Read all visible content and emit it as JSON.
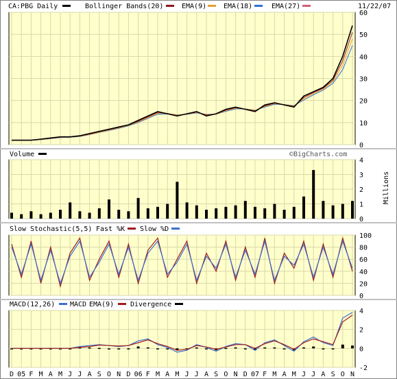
{
  "header": {
    "symbol_label": "CA:PBG Daily",
    "bollinger_label": "Bollinger Bands(20)",
    "ema1_label": "EMA(9)",
    "ema2_label": "EMA(18)",
    "ema3_label": "EMA(27)",
    "date": "11/22/07"
  },
  "colors": {
    "panel_bg": "#ffffcc",
    "grid": "#d8d8a8",
    "price": "#000000",
    "bollinger": "#8b1a1a",
    "ema9": "#9e1b1b",
    "ema18": "#e0a030",
    "ema27": "#2b6fd6",
    "fast_k": "#9e1b1b",
    "slow_d": "#3b6fd0",
    "macd": "#3b6fd0",
    "macd_ema": "#9e1b1b",
    "divergence": "#000000"
  },
  "panels": {
    "volume": {
      "label": "Volume",
      "watermark": "©BigCharts.com",
      "unit": "Millions"
    },
    "stochastic": {
      "label": "Slow Stochastic(5,5)",
      "fast_label": "Fast %K",
      "slow_label": "Slow %D"
    },
    "macd": {
      "label": "MACD(12,26)",
      "macd_label": "MACD",
      "ema_label": "EMA(9)",
      "divergence_label": "Divergence"
    }
  },
  "chart_data": [
    {
      "type": "line",
      "title": "CA:PBG Daily",
      "ylim": [
        0,
        60
      ],
      "yticks": [
        0,
        10,
        20,
        30,
        40,
        50,
        60
      ],
      "x": [
        "D",
        "05",
        "F",
        "M",
        "A",
        "M",
        "J",
        "J",
        "A",
        "S",
        "O",
        "N",
        "D",
        "06",
        "F",
        "M",
        "A",
        "M",
        "J",
        "J",
        "A",
        "S",
        "O",
        "N",
        "D",
        "07",
        "F",
        "M",
        "A",
        "M",
        "J",
        "J",
        "A",
        "S",
        "O",
        "N"
      ],
      "series": [
        {
          "name": "CA:PBG",
          "values": [
            2,
            2,
            2,
            2.5,
            3,
            3.5,
            3.5,
            4,
            5,
            6,
            7,
            8,
            9,
            11,
            13,
            15,
            14,
            13,
            14,
            15,
            13,
            14,
            16,
            17,
            16,
            15,
            18,
            19,
            18,
            17,
            22,
            24,
            26,
            30,
            40,
            54
          ]
        },
        {
          "name": "EMA(9)",
          "values": [
            2,
            2,
            2,
            2.4,
            2.9,
            3.4,
            3.5,
            3.9,
            4.8,
            5.8,
            6.8,
            7.8,
            8.9,
            10.6,
            12.6,
            14.6,
            14.1,
            13.2,
            13.9,
            14.8,
            13.4,
            13.9,
            15.7,
            16.8,
            16.1,
            15.3,
            17.6,
            18.8,
            18.1,
            17.3,
            21.4,
            23.6,
            25.6,
            29.2,
            38,
            51
          ]
        },
        {
          "name": "EMA(18)",
          "values": [
            2,
            2,
            2,
            2.3,
            2.8,
            3.3,
            3.4,
            3.8,
            4.6,
            5.6,
            6.6,
            7.6,
            8.7,
            10.3,
            12.2,
            14.2,
            14.1,
            13.4,
            13.8,
            14.6,
            13.6,
            13.8,
            15.4,
            16.5,
            16.2,
            15.5,
            17.3,
            18.6,
            18.2,
            17.5,
            20.8,
            23.1,
            25.2,
            28.5,
            36,
            48
          ]
        },
        {
          "name": "EMA(27)",
          "values": [
            2,
            2,
            2,
            2.2,
            2.7,
            3.2,
            3.3,
            3.7,
            4.5,
            5.5,
            6.4,
            7.4,
            8.5,
            10,
            11.9,
            13.8,
            13.9,
            13.5,
            13.7,
            14.4,
            13.7,
            13.8,
            15.1,
            16.2,
            16.2,
            15.6,
            17,
            18.3,
            18.2,
            17.7,
            20.2,
            22.6,
            24.7,
            27.8,
            34,
            45
          ]
        }
      ]
    },
    {
      "type": "bar",
      "title": "Volume",
      "ylabel": "Millions",
      "ylim": [
        0,
        4
      ],
      "yticks": [
        0,
        1,
        2,
        3,
        4
      ],
      "values": [
        0.4,
        0.3,
        0.5,
        0.3,
        0.4,
        0.6,
        1.1,
        0.5,
        0.4,
        0.7,
        1.3,
        0.6,
        0.5,
        1.4,
        0.7,
        0.8,
        1.0,
        2.5,
        1.1,
        0.9,
        0.6,
        0.7,
        0.8,
        0.9,
        1.2,
        0.8,
        0.7,
        1.0,
        0.6,
        0.8,
        1.5,
        3.3,
        1.2,
        0.9,
        1.0,
        1.2
      ]
    },
    {
      "type": "line",
      "title": "Slow Stochastic(5,5)",
      "ylim": [
        0,
        100
      ],
      "yticks": [
        0,
        20,
        40,
        60,
        80,
        100
      ],
      "series": [
        {
          "name": "Fast %K",
          "values": [
            85,
            30,
            90,
            20,
            80,
            15,
            70,
            95,
            25,
            60,
            90,
            30,
            85,
            20,
            75,
            95,
            30,
            60,
            90,
            20,
            70,
            40,
            90,
            25,
            80,
            30,
            95,
            20,
            70,
            45,
            90,
            25,
            85,
            30,
            95,
            40
          ]
        },
        {
          "name": "Slow %D",
          "values": [
            80,
            35,
            85,
            25,
            75,
            20,
            65,
            90,
            30,
            55,
            85,
            35,
            80,
            25,
            70,
            90,
            35,
            55,
            85,
            25,
            65,
            45,
            85,
            30,
            75,
            35,
            90,
            25,
            65,
            50,
            85,
            30,
            80,
            35,
            90,
            45
          ]
        }
      ]
    },
    {
      "type": "line",
      "title": "MACD(12,26)",
      "ylim": [
        -2,
        4
      ],
      "yticks": [
        -2,
        0,
        2,
        4
      ],
      "series": [
        {
          "name": "MACD",
          "values": [
            0,
            0,
            0,
            0,
            0,
            0,
            0,
            0.2,
            0.3,
            0.4,
            0.3,
            0.2,
            0.3,
            0.8,
            1.0,
            0.4,
            0.1,
            -0.4,
            -0.2,
            0.4,
            0.1,
            -0.3,
            0.2,
            0.5,
            0.4,
            -0.2,
            0.6,
            0.9,
            0.3,
            -0.3,
            0.7,
            1.2,
            0.6,
            0.3,
            3.2,
            3.8
          ]
        },
        {
          "name": "EMA(9)",
          "values": [
            0,
            0,
            0,
            0,
            0,
            0,
            0,
            0.1,
            0.2,
            0.35,
            0.3,
            0.25,
            0.3,
            0.6,
            0.9,
            0.5,
            0.2,
            -0.2,
            -0.1,
            0.3,
            0.15,
            -0.1,
            0.15,
            0.4,
            0.4,
            0,
            0.5,
            0.8,
            0.4,
            -0.1,
            0.6,
            1.0,
            0.7,
            0.4,
            2.8,
            3.5
          ]
        },
        {
          "name": "Divergence",
          "values": [
            0,
            0,
            0,
            0,
            0,
            0,
            0,
            0.1,
            0.1,
            0.05,
            0,
            -0.05,
            0,
            0.2,
            0.1,
            -0.1,
            -0.1,
            -0.2,
            -0.1,
            0.1,
            -0.05,
            -0.2,
            0.05,
            0.1,
            0,
            -0.2,
            0.1,
            0.1,
            -0.1,
            -0.2,
            0.1,
            0.2,
            -0.1,
            -0.1,
            0.4,
            0.3
          ]
        }
      ]
    }
  ]
}
